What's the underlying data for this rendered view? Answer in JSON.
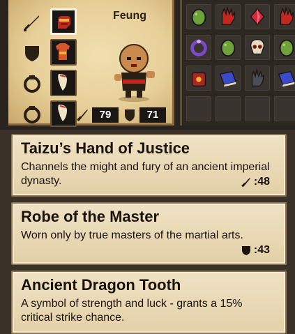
{
  "hero": {
    "name": "Feung",
    "attack": "79",
    "defense": "71"
  },
  "slots": [
    {
      "type": "weapon-slot",
      "item": "sword-item",
      "selected": true
    },
    {
      "type": "armor-slot",
      "item": "robe-item",
      "selected": false
    },
    {
      "type": "accessory-slot",
      "item": "tooth-item",
      "selected": false
    },
    {
      "type": "accessory-slot",
      "item": "tooth-item",
      "selected": false
    }
  ],
  "inventory": [
    [
      "green-egg-icon",
      "red-glove-icon",
      "red-gem-icon",
      "red-glove-icon"
    ],
    [
      "purple-ring-icon",
      "green-egg-icon",
      "skull-icon",
      "green-egg-icon"
    ],
    [
      "red-bag-icon",
      "blue-book-icon",
      "dark-glove-icon",
      "blue-book-icon"
    ],
    [
      "empty",
      "empty",
      "empty",
      "empty"
    ]
  ],
  "items": [
    {
      "title": "Taizu’s Hand of Justice",
      "description": "Channels the might and fury of an ancient imperial dynasty.",
      "stat_icon": "sword-icon",
      "stat_value": ":48"
    },
    {
      "title": "Robe of the Master",
      "description": "Worn only by true masters of the martial arts.",
      "stat_icon": "shield-icon",
      "stat_value": ":43"
    },
    {
      "title": "Ancient Dragon Tooth",
      "description": "A symbol of strength and luck - grants a 15% critical strike chance.",
      "stat_icon": "",
      "stat_value": ""
    }
  ]
}
